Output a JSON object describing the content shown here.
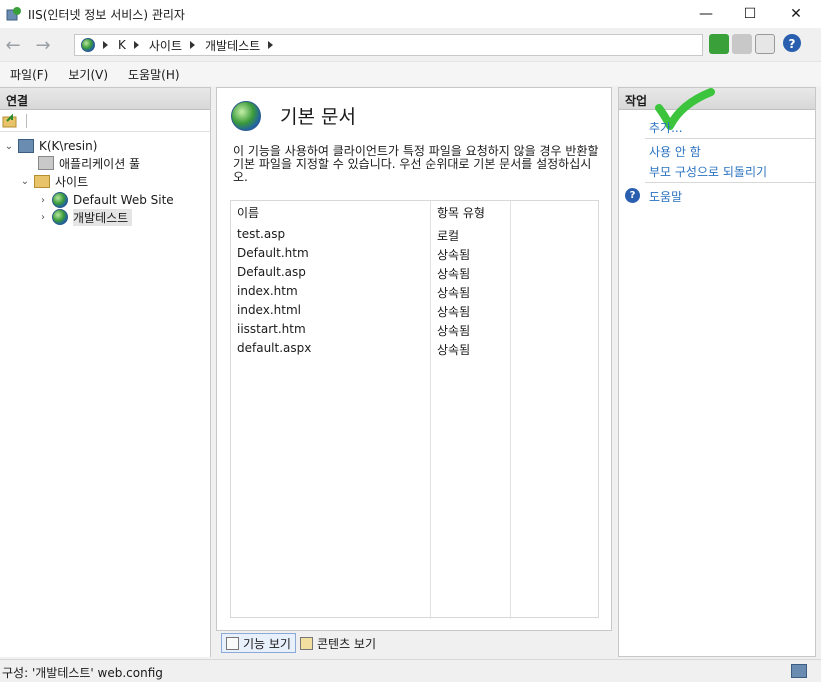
{
  "window": {
    "title": "IIS(인터넷 정보 서비스) 관리자",
    "minimize": "—",
    "maximize": "☐",
    "close": "✕"
  },
  "address": {
    "back": "←",
    "forward": "→",
    "segments": [
      "K",
      "사이트",
      "개발테스트"
    ]
  },
  "toolbar": {
    "help": "?"
  },
  "menu": {
    "items": [
      "파일(F)",
      "보기(V)",
      "도움말(H)"
    ]
  },
  "connections": {
    "header": "연결",
    "tree": [
      {
        "label": "K(K\\resin)",
        "icon": "server-icon",
        "expanded": true
      },
      {
        "label": "애플리케이션 풀",
        "icon": "app-pool-icon"
      },
      {
        "label": "사이트",
        "icon": "sites-folder-icon",
        "expanded": true
      },
      {
        "label": "Default Web Site",
        "icon": "globe-icon",
        "expanded": false
      },
      {
        "label": "개발테스트",
        "icon": "globe-icon",
        "expanded": false,
        "selected": true
      }
    ]
  },
  "feature": {
    "title": "기본 문서",
    "description": "이 기능을 사용하여 클라이언트가 특정 파일을 요청하지 않을 경우 반환할 기본 파일을 지정할 수 있습니다. 우선 순위대로 기본 문서를 설정하십시오.",
    "columns": [
      "이름",
      "항목 유형"
    ],
    "rows": [
      {
        "name": "test.asp",
        "type": "로컬"
      },
      {
        "name": "Default.htm",
        "type": "상속됨"
      },
      {
        "name": "Default.asp",
        "type": "상속됨"
      },
      {
        "name": "index.htm",
        "type": "상속됨"
      },
      {
        "name": "index.html",
        "type": "상속됨"
      },
      {
        "name": "iisstart.htm",
        "type": "상속됨"
      },
      {
        "name": "default.aspx",
        "type": "상속됨"
      }
    ]
  },
  "views": {
    "features_view": "기능 보기",
    "content_view": "콘텐츠 보기"
  },
  "actions": {
    "header": "작업",
    "add": "추가...",
    "disable": "사용 안 함",
    "revert": "부모 구성으로 되돌리기",
    "help": "도움말"
  },
  "status": {
    "text": "구성: '개발테스트' web.config"
  },
  "colors": {
    "link": "#2a73c0",
    "checkmark": "#3cc43c"
  }
}
